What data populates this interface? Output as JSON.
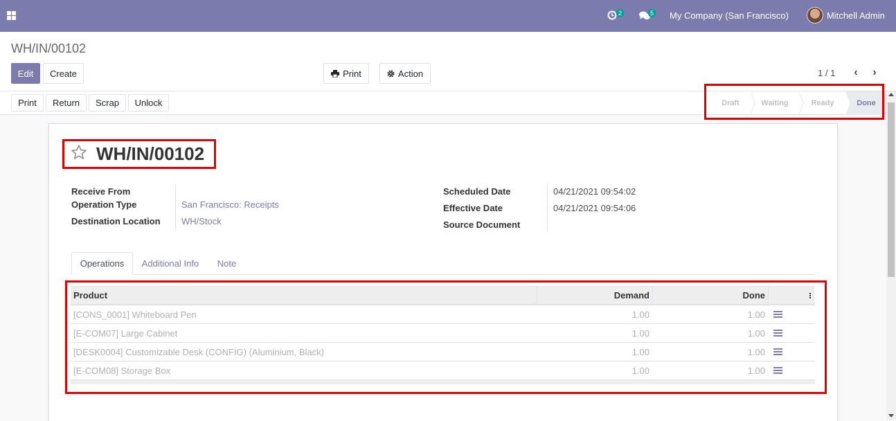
{
  "navbar": {
    "activity_count": "2",
    "message_count": "5",
    "company": "My Company (San Francisco)",
    "user": "Mitchell Admin",
    "color": "#7c7bad"
  },
  "control": {
    "breadcrumb": "WH/IN/00102",
    "edit_label": "Edit",
    "create_label": "Create",
    "print_label": "Print",
    "action_label": "Action",
    "pager": "1 / 1"
  },
  "statusbar": {
    "buttons": [
      "Print",
      "Return",
      "Scrap",
      "Unlock"
    ],
    "stages": [
      "Draft",
      "Waiting",
      "Ready",
      "Done"
    ],
    "active_stage": "Done"
  },
  "record": {
    "title": "WH/IN/00102",
    "left_fields": [
      {
        "label": "Receive From",
        "value": ""
      },
      {
        "label": "Operation Type",
        "value": "San Francisco: Receipts"
      },
      {
        "label": "Destination Location",
        "value": "WH/Stock"
      }
    ],
    "right_fields": [
      {
        "label": "Scheduled Date",
        "value": "04/21/2021 09:54:02"
      },
      {
        "label": "Effective Date",
        "value": "04/21/2021 09:54:06"
      },
      {
        "label": "Source Document",
        "value": ""
      }
    ]
  },
  "tabs": [
    "Operations",
    "Additional Info",
    "Note"
  ],
  "table": {
    "headers": [
      "Product",
      "Demand",
      "Done"
    ],
    "rows": [
      {
        "product": "[CONS_0001] Whiteboard Pen",
        "demand": "1.00",
        "done": "1.00"
      },
      {
        "product": "[E-COM07] Large Cabinet",
        "demand": "1.00",
        "done": "1.00"
      },
      {
        "product": "[DESK0004] Customizable Desk (CONFIG) (Aluminium, Black)",
        "demand": "1.00",
        "done": "1.00"
      },
      {
        "product": "[E-COM08] Storage Box",
        "demand": "1.00",
        "done": "1.00"
      }
    ]
  },
  "highlight_color": "#e00000"
}
